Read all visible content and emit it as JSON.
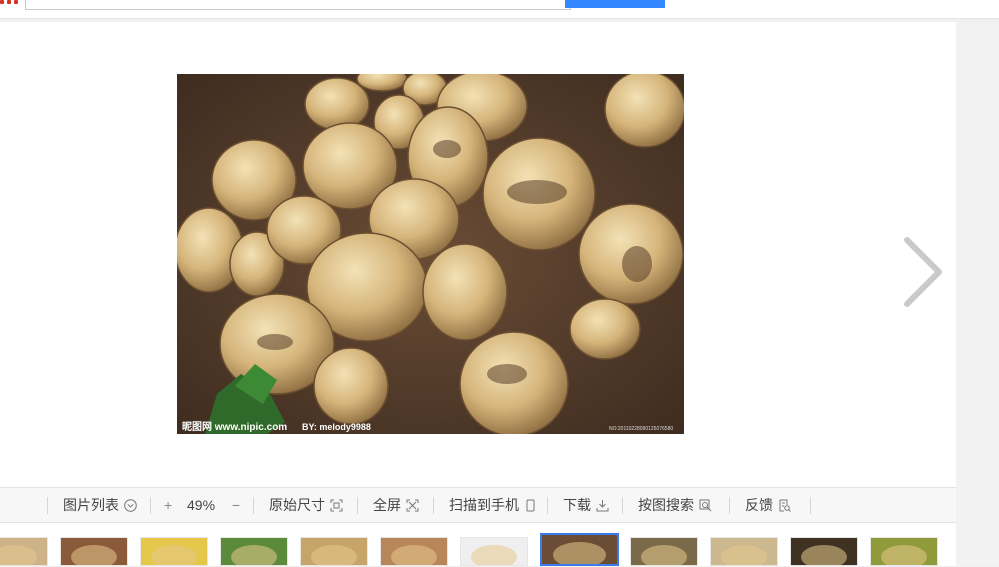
{
  "header": {
    "search": {
      "value": "",
      "placeholder": ""
    },
    "search_button_label": ""
  },
  "viewer": {
    "photo": {
      "watermark_site": "昵图网 www.nipic.com",
      "watermark_author": "BY: melody9988",
      "watermark_id": "NO:20110228090125076580"
    },
    "next_icon": "chevron-right-icon"
  },
  "toolbar": {
    "image_list_label": "图片列表",
    "zoom_in_label": "+",
    "zoom_value": "49%",
    "zoom_out_label": "−",
    "original_size_label": "原始尺寸",
    "fullscreen_label": "全屏",
    "scan_to_phone_label": "扫描到手机",
    "download_label": "下载",
    "search_by_image_label": "按图搜索",
    "feedback_label": "反馈"
  },
  "thumbnails": {
    "active_index": 7,
    "items": [
      {
        "color": "#cdb28a"
      },
      {
        "color": "#8a5a3a"
      },
      {
        "color": "#e5c84a"
      },
      {
        "color": "#5b8a3a"
      },
      {
        "color": "#c7a46a"
      },
      {
        "color": "#b9865a"
      },
      {
        "color": "#efefef"
      },
      {
        "color": "#6b4d36"
      },
      {
        "color": "#7a6a4a"
      },
      {
        "color": "#cbb88e"
      },
      {
        "color": "#3f3223"
      },
      {
        "color": "#8f9a3a"
      }
    ]
  },
  "colors": {
    "accent": "#3388ff",
    "active_thumb_border": "#3a7cf0",
    "logo_red": "#d93025"
  }
}
